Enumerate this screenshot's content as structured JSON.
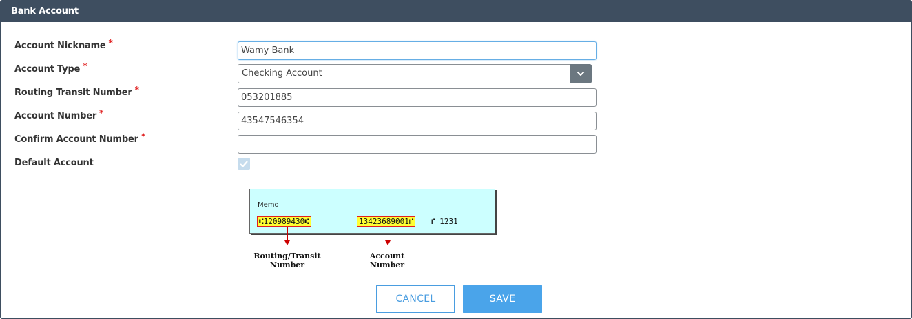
{
  "panel": {
    "title": "Bank Account"
  },
  "form": {
    "nickname": {
      "label": "Account Nickname",
      "required": "*",
      "value": "Wamy Bank"
    },
    "account_type": {
      "label": "Account Type",
      "required": "*",
      "value": "Checking Account"
    },
    "routing": {
      "label": "Routing Transit Number",
      "required": "*",
      "value": "053201885"
    },
    "account_number": {
      "label": "Account Number",
      "required": "*",
      "value": "43547546354"
    },
    "confirm_account": {
      "label": "Confirm Account Number",
      "required": "*",
      "value": ""
    },
    "default_account": {
      "label": "Default Account",
      "checked": true
    }
  },
  "check_image": {
    "memo": "Memo",
    "routing_micr": "⑆120989430⑆",
    "account_micr": "13423689001⑈",
    "check_no_micr": "⑈  1231",
    "routing_caption_1": "Routing/Transit",
    "routing_caption_2": "Number",
    "account_caption_1": "Account",
    "account_caption_2": "Number"
  },
  "buttons": {
    "cancel": "CANCEL",
    "save": "SAVE"
  },
  "colors": {
    "header": "#3e4e60",
    "accent": "#4aa4ea",
    "required": "#e02020"
  }
}
